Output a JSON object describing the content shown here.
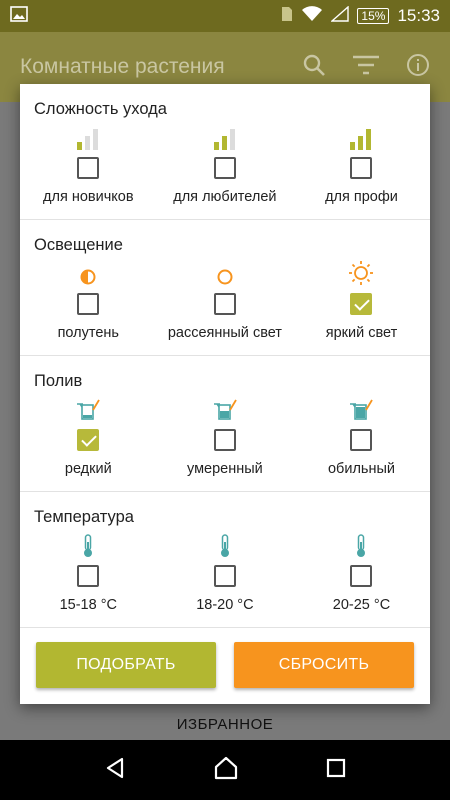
{
  "status_bar": {
    "battery": "15%",
    "time": "15:33"
  },
  "app_bar": {
    "title": "Комнатные растения"
  },
  "background": {
    "favorites_label": "ИЗБРАННОЕ"
  },
  "dialog": {
    "sections": [
      {
        "title": "Сложность ухода",
        "options": [
          {
            "label": "для новичков",
            "icon": "signal-low-icon",
            "checked": false
          },
          {
            "label": "для любителей",
            "icon": "signal-medium-icon",
            "checked": false
          },
          {
            "label": "для профи",
            "icon": "signal-high-icon",
            "checked": false
          }
        ]
      },
      {
        "title": "Освещение",
        "options": [
          {
            "label": "полутень",
            "icon": "half-sun-icon",
            "checked": false
          },
          {
            "label": "рассеянный свет",
            "icon": "circle-sun-icon",
            "checked": false
          },
          {
            "label": "яркий свет",
            "icon": "bright-sun-icon",
            "checked": true
          }
        ]
      },
      {
        "title": "Полив",
        "options": [
          {
            "label": "редкий",
            "icon": "watering-can-low-icon",
            "checked": true
          },
          {
            "label": "умеренный",
            "icon": "watering-can-medium-icon",
            "checked": false
          },
          {
            "label": "обильный",
            "icon": "watering-can-high-icon",
            "checked": false
          }
        ]
      },
      {
        "title": "Температура",
        "options": [
          {
            "label": "15-18 °C",
            "icon": "thermometer-icon",
            "checked": false
          },
          {
            "label": "18-20 °C",
            "icon": "thermometer-icon",
            "checked": false
          },
          {
            "label": "20-25 °C",
            "icon": "thermometer-icon",
            "checked": false
          }
        ]
      }
    ],
    "buttons": {
      "pick": "ПОДОБРАТЬ",
      "reset": "СБРОСИТЬ"
    }
  },
  "colors": {
    "accent_green": "#b2b731",
    "accent_orange": "#f7941e",
    "icon_teal": "#4aa6a6"
  }
}
